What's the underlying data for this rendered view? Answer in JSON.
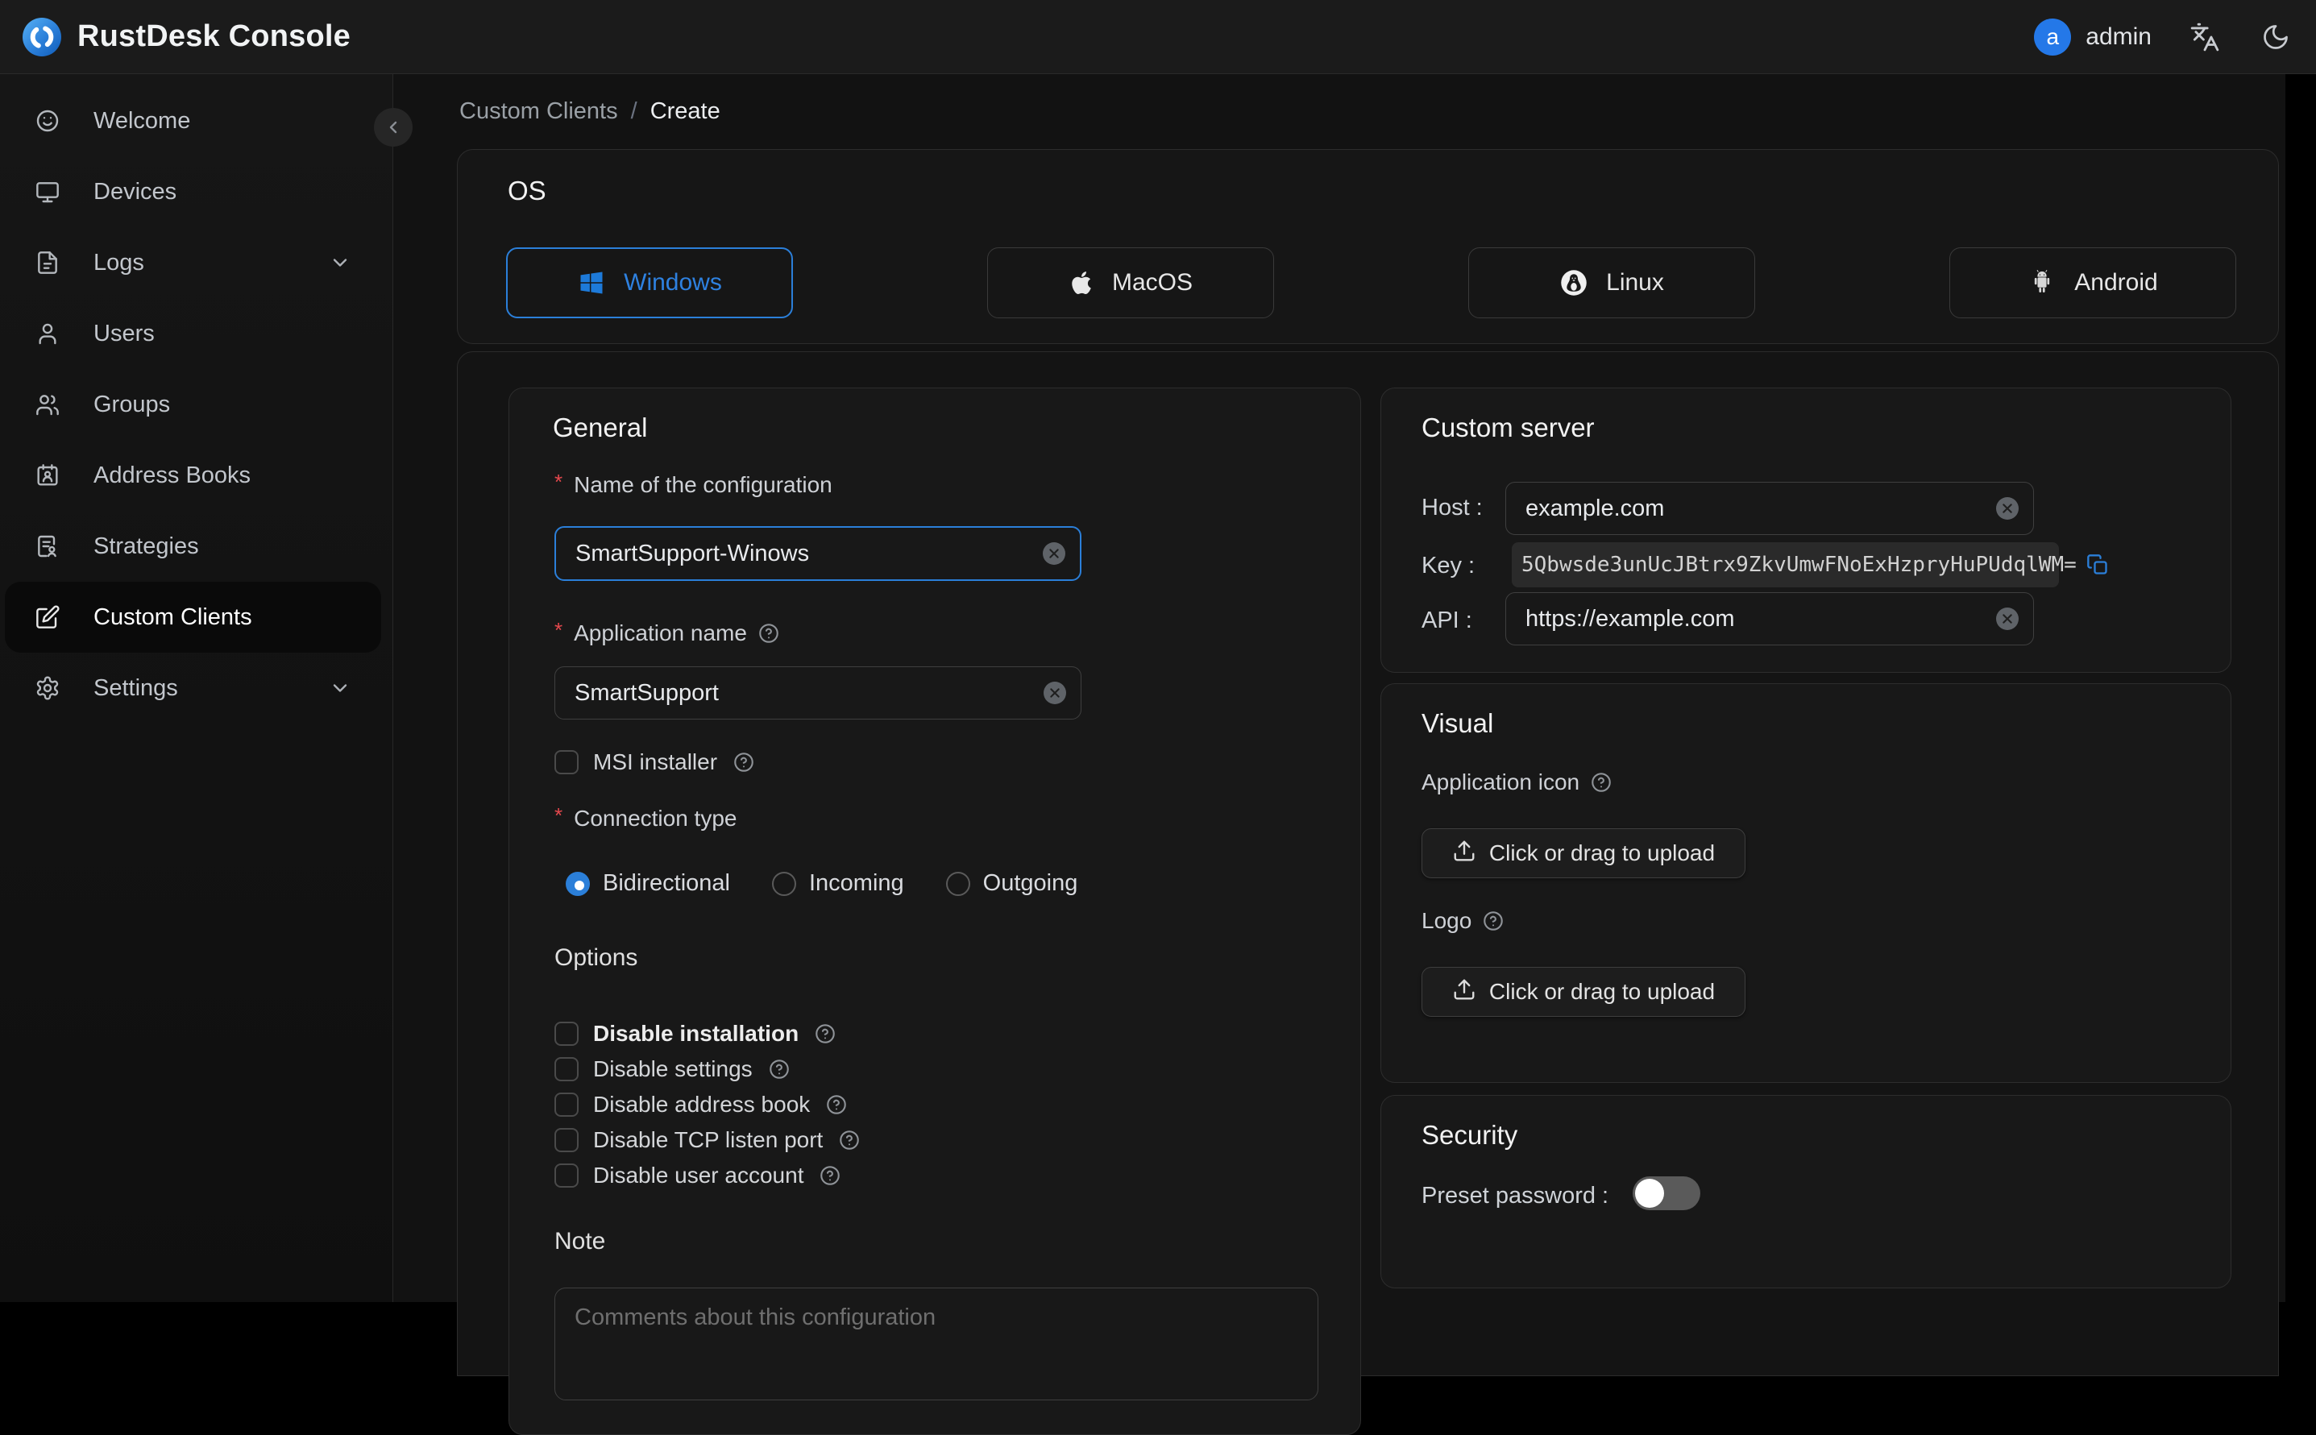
{
  "header": {
    "title": "RustDesk Console",
    "user": {
      "initial": "a",
      "name": "admin"
    }
  },
  "sidebar": {
    "items": [
      {
        "label": "Welcome"
      },
      {
        "label": "Devices"
      },
      {
        "label": "Logs",
        "expandable": true
      },
      {
        "label": "Users"
      },
      {
        "label": "Groups"
      },
      {
        "label": "Address Books"
      },
      {
        "label": "Strategies"
      },
      {
        "label": "Custom Clients",
        "active": true
      },
      {
        "label": "Settings",
        "expandable": true
      }
    ]
  },
  "breadcrumb": {
    "parent": "Custom Clients",
    "separator": "/",
    "current": "Create"
  },
  "required_marker": "*",
  "os_section": {
    "title": "OS",
    "options": [
      {
        "label": "Windows",
        "selected": true
      },
      {
        "label": "MacOS",
        "selected": false
      },
      {
        "label": "Linux",
        "selected": false
      },
      {
        "label": "Android",
        "selected": false
      }
    ]
  },
  "general": {
    "title": "General",
    "name_label": "Name of the configuration",
    "name_value": "SmartSupport-Winows",
    "app_name_label": "Application name",
    "app_name_value": "SmartSupport",
    "msi_label": "MSI installer",
    "connection_type_label": "Connection type",
    "connection_options": [
      {
        "label": "Bidirectional",
        "selected": true
      },
      {
        "label": "Incoming",
        "selected": false
      },
      {
        "label": "Outgoing",
        "selected": false
      }
    ],
    "options_title": "Options",
    "option_checkboxes": [
      {
        "label": "Disable installation",
        "checked": false
      },
      {
        "label": "Disable settings",
        "checked": false
      },
      {
        "label": "Disable address book",
        "checked": false
      },
      {
        "label": "Disable TCP listen port",
        "checked": false
      },
      {
        "label": "Disable user account",
        "checked": false
      }
    ],
    "note_label": "Note",
    "note_placeholder": "Comments about this configuration"
  },
  "custom_server": {
    "title": "Custom server",
    "host_label": "Host :",
    "host_value": "example.com",
    "key_label": "Key :",
    "key_value": "5Qbwsde3unUcJBtrx9ZkvUmwFNoExHzpryHuPUdqlWM=",
    "api_label": "API :",
    "api_value": "https://example.com"
  },
  "visual": {
    "title": "Visual",
    "app_icon_label": "Application icon",
    "logo_label": "Logo",
    "upload_label": "Click or drag to upload"
  },
  "security": {
    "title": "Security",
    "preset_password_label": "Preset password :",
    "preset_password_enabled": false
  },
  "colors": {
    "accent_blue": "#2b7fd9",
    "required_red": "#e5484d",
    "panel_bg": "#181818",
    "page_bg": "#121212"
  }
}
